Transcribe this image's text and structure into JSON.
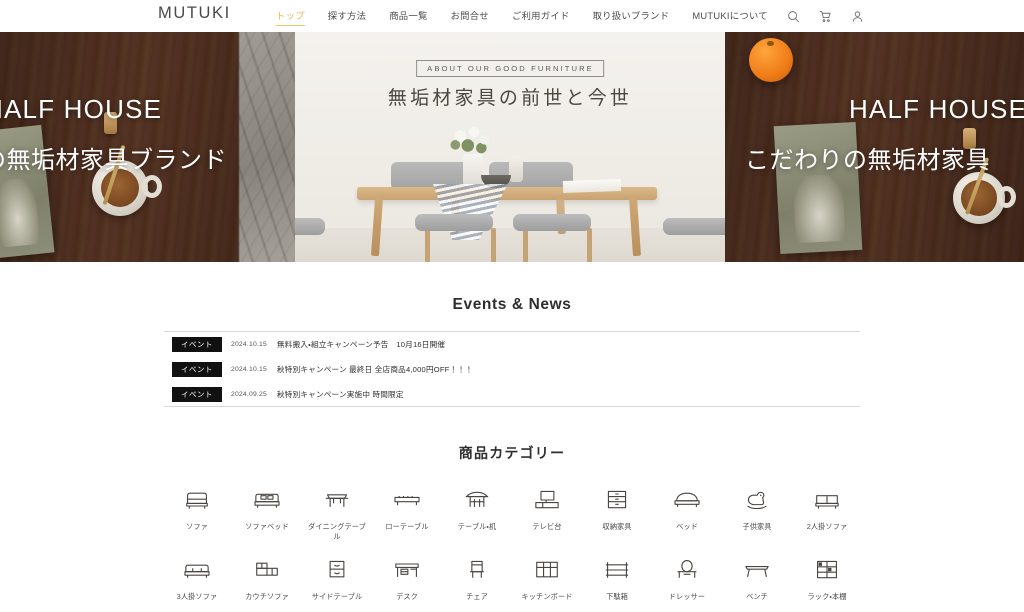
{
  "header": {
    "logo": "MUTUKI",
    "nav": [
      {
        "label": "トップ",
        "active": true
      },
      {
        "label": "探す方法",
        "active": false
      },
      {
        "label": "商品一覧",
        "active": false
      },
      {
        "label": "お問合せ",
        "active": false
      },
      {
        "label": "ご利用ガイド",
        "active": false
      },
      {
        "label": "取り扱いブランド",
        "active": false
      },
      {
        "label": "MUTUKIについて",
        "active": false
      }
    ],
    "icons": [
      {
        "name": "search-icon"
      },
      {
        "name": "cart-icon"
      },
      {
        "name": "account-icon"
      }
    ],
    "active_color": "#f0b54a"
  },
  "hero": {
    "slides": [
      {
        "id": "slide-left",
        "headline_en": "HALF HOUSE",
        "headline_jp": "の無垢材家具ブランド"
      },
      {
        "id": "slide-center",
        "badge": "ABOUT OUR GOOD FURNITURE",
        "headline_jp": "無垢材家具の前世と今世"
      },
      {
        "id": "slide-right",
        "headline_en": "HALF HOUSE",
        "headline_jp": "こだわりの無垢材家具"
      }
    ]
  },
  "news": {
    "title": "Events & News",
    "badge_label": "イベント",
    "items": [
      {
        "badge": "イベント",
        "date": "2024.10.15",
        "text": "無料搬入・組立キャンペーン予告　10月16日開催"
      },
      {
        "badge": "イベント",
        "date": "2024.10.15",
        "text": "秋特別キャンペーン 最終日 全店商品4,000円OFF！！！"
      },
      {
        "badge": "イベント",
        "date": "2024.09.25",
        "text": "秋特別キャンペーン実施中 時間限定"
      }
    ]
  },
  "categories": {
    "title": "商品カテゴリー",
    "items": [
      {
        "label": "ソファ",
        "icon": "sofa-icon"
      },
      {
        "label": "ソファベッド",
        "icon": "sofa-bed-icon"
      },
      {
        "label": "ダイニングテーブル",
        "icon": "dining-table-icon"
      },
      {
        "label": "ローテーブル",
        "icon": "low-table-icon"
      },
      {
        "label": "テーブル・机",
        "icon": "table-desk-icon"
      },
      {
        "label": "テレビ台",
        "icon": "tv-stand-icon"
      },
      {
        "label": "収納家具",
        "icon": "storage-icon"
      },
      {
        "label": "ベッド",
        "icon": "bed-icon"
      },
      {
        "label": "子供家具",
        "icon": "kids-furniture-icon"
      },
      {
        "label": "2人掛ソファ",
        "icon": "two-seat-sofa-icon"
      },
      {
        "label": "3人掛ソファ",
        "icon": "three-seat-sofa-icon"
      },
      {
        "label": "カウチソファ",
        "icon": "couch-sofa-icon"
      },
      {
        "label": "サイドテーブル",
        "icon": "side-table-icon"
      },
      {
        "label": "デスク",
        "icon": "desk-icon"
      },
      {
        "label": "チェア",
        "icon": "chair-icon"
      },
      {
        "label": "キッチンボード",
        "icon": "kitchen-board-icon"
      },
      {
        "label": "下駄箱",
        "icon": "shoe-rack-icon"
      },
      {
        "label": "ドレッサー",
        "icon": "dresser-icon"
      },
      {
        "label": "ベンチ",
        "icon": "bench-icon"
      },
      {
        "label": "ラック・本棚",
        "icon": "rack-shelf-icon"
      }
    ]
  }
}
